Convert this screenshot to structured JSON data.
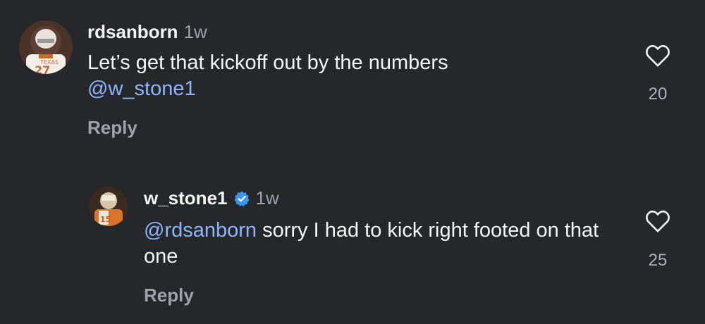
{
  "comments": [
    {
      "username": "rdsanborn",
      "time": "1w",
      "text": "Let’s get that kickoff out by the numbers ",
      "mention": "@w_stone1",
      "like_count": "20",
      "reply_label": "Reply",
      "verified": false
    },
    {
      "username": "w_stone1",
      "time": "1w",
      "mention": "@rdsanborn",
      "text": " sorry I had to kick right footed on that one",
      "like_count": "25",
      "reply_label": "Reply",
      "verified": true
    }
  ],
  "colors": {
    "background": "#25272b",
    "mention": "#8fb5ff",
    "verified": "#3797f0",
    "secondary_text": "#a0a2a8"
  },
  "icons": [
    "heart-icon",
    "verified-badge-icon"
  ]
}
